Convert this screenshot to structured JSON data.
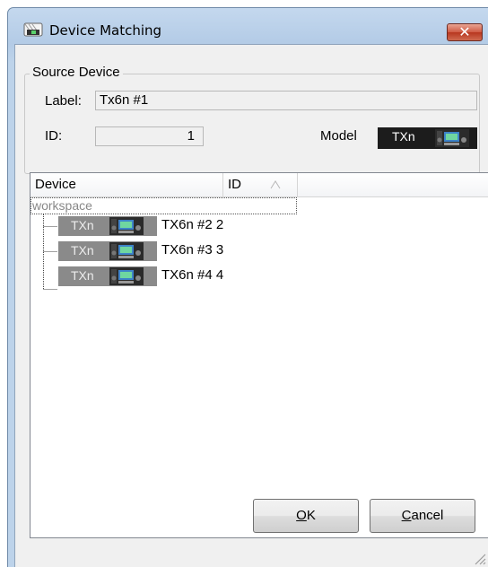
{
  "window": {
    "title": "Device Matching",
    "close_symbol": "✕"
  },
  "source_device": {
    "group_title": "Source Device",
    "label_caption": "Label:",
    "label_value": "Tx6n #1",
    "id_caption": "ID:",
    "id_value": "1",
    "model_caption": "Model",
    "model_value": "TXn"
  },
  "list": {
    "columns": [
      "Device",
      "ID"
    ],
    "sorted_column": "ID",
    "sort_direction": "ascending",
    "root": "workspace",
    "items": [
      {
        "model": "TXn",
        "name": "TX6n #2",
        "id": "2"
      },
      {
        "model": "TXn",
        "name": "TX6n #3",
        "id": "3"
      },
      {
        "model": "TXn",
        "name": "TX6n #4",
        "id": "4"
      }
    ]
  },
  "buttons": {
    "ok": {
      "accel": "O",
      "rest": "K"
    },
    "cancel": {
      "accel": "C",
      "rest": "ancel"
    }
  },
  "icons": {
    "app": "device-matching-app-icon",
    "device": "amplifier-device-icon",
    "sort": "sort-ascending-icon",
    "grip": "resize-grip-icon"
  }
}
